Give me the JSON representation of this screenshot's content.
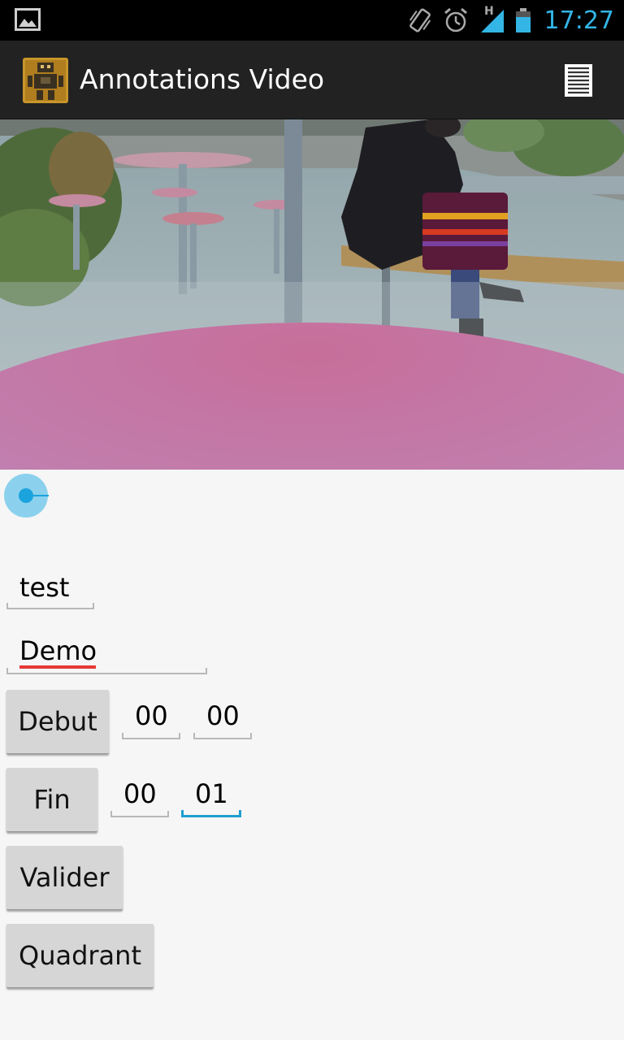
{
  "status_bar": {
    "time": "17:27",
    "network_type": "H",
    "icons": [
      "gallery-icon",
      "vibrate-icon",
      "alarm-icon",
      "signal-icon",
      "battery-icon"
    ],
    "accent_color": "#33b5e5"
  },
  "action_bar": {
    "title": "Annotations Video",
    "app_icon": "robot-app-icon",
    "overflow_icon": "menu-list-icon"
  },
  "video": {
    "description_icon": "video-frame"
  },
  "form": {
    "field1_value": "test",
    "field2_value": "Demo",
    "debut_label": "Debut",
    "debut_min": "00",
    "debut_sec": "00",
    "fin_label": "Fin",
    "fin_min": "00",
    "fin_sec": "01",
    "valider_label": "Valider",
    "quadrant_label": "Quadrant"
  }
}
